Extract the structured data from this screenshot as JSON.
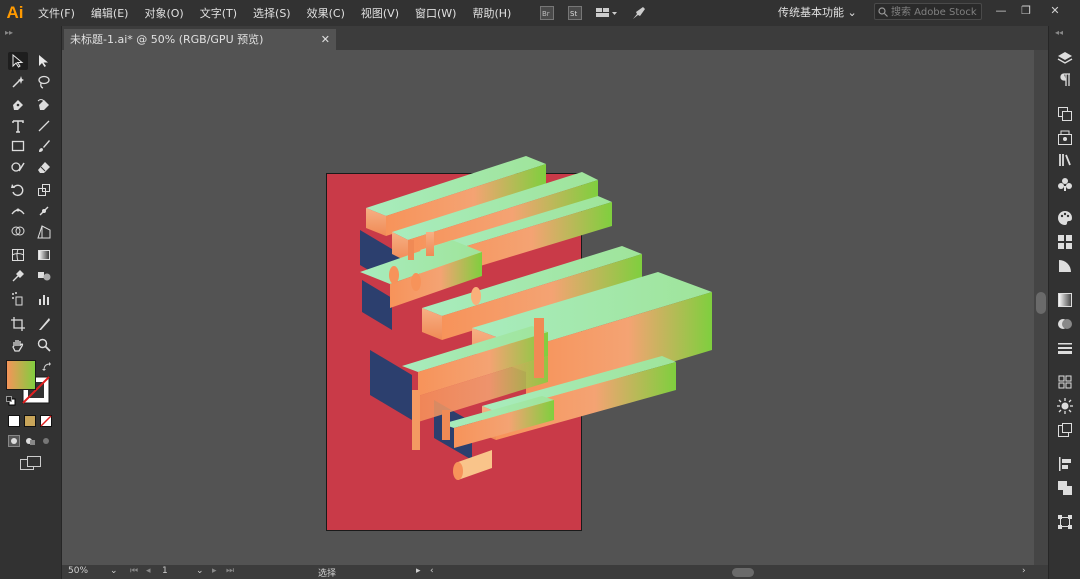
{
  "app": {
    "logo": "Ai"
  },
  "menu": [
    "文件(F)",
    "编辑(E)",
    "对象(O)",
    "文字(T)",
    "选择(S)",
    "效果(C)",
    "视图(V)",
    "窗口(W)",
    "帮助(H)"
  ],
  "menubar_icons": {
    "bridge": "Br",
    "stock": "St"
  },
  "workspace": {
    "label": "传统基本功能",
    "arrow": "⌄"
  },
  "search": {
    "placeholder": "搜索 Adobe Stock"
  },
  "window_controls": {
    "minimize": "—",
    "restore": "❐",
    "close": "✕"
  },
  "document_tab": {
    "title": "未标题-1.ai* @ 50% (RGB/GPU 预览)",
    "close": "✕"
  },
  "statusbar": {
    "zoom": "50%",
    "page": "1",
    "tool": "选择"
  },
  "colors": {
    "accent": "#ff9a00",
    "artboard": "#c93a48",
    "grad_start": "#f7935a",
    "grad_mid": "#a8ecbe",
    "grad_end": "#7fcf3e",
    "shadow": "#2c3f6e"
  }
}
